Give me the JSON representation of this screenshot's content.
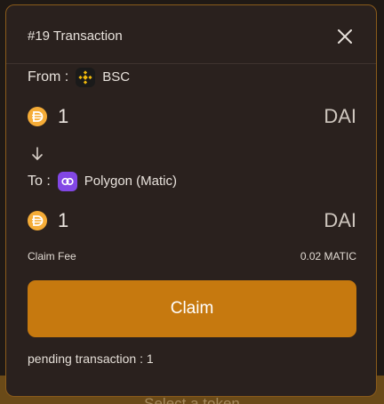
{
  "background": {
    "bottom_button_label": "Select a token"
  },
  "modal": {
    "title": "#19 Transaction",
    "from": {
      "label": "From :",
      "chain_name": "BSC",
      "chain_icon": "bnb-chain-icon"
    },
    "from_amount": {
      "value": "1",
      "symbol": "DAI",
      "token_icon": "dai-token-icon"
    },
    "direction_icon": "arrow-down-icon",
    "to": {
      "label": "To :",
      "chain_name": "Polygon (Matic)",
      "chain_icon": "polygon-chain-icon"
    },
    "to_amount": {
      "value": "1",
      "symbol": "DAI",
      "token_icon": "dai-token-icon"
    },
    "fee": {
      "label": "Claim Fee",
      "value": "0.02 MATIC"
    },
    "claim_button_label": "Claim",
    "pending_text": "pending transaction : 1"
  },
  "colors": {
    "accent": "#c6790f",
    "modal_bg": "#2a211e",
    "modal_border": "#8a5b1b",
    "dai_yellow": "#f5ac37",
    "polygon_purple": "#8247e5",
    "bnb_yellow": "#f0b90b"
  }
}
